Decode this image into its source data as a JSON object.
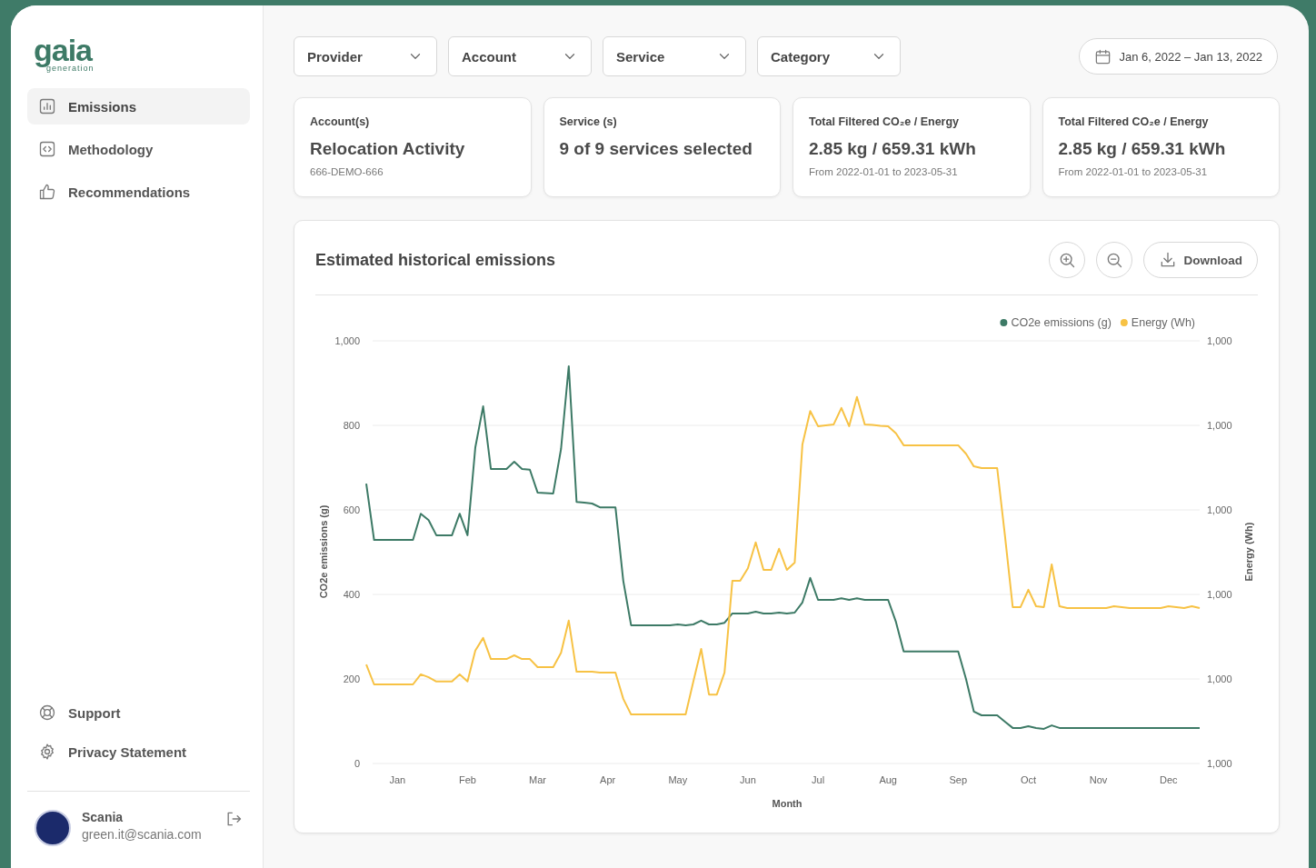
{
  "sidebar": {
    "logo": {
      "wordmark": "gaia",
      "tagline": "generation"
    },
    "nav": [
      {
        "label": "Emissions",
        "selected": true
      },
      {
        "label": "Methodology",
        "selected": false
      },
      {
        "label": "Recommendations",
        "selected": false
      }
    ],
    "footer_links": [
      "Support",
      "Privacy Statement"
    ],
    "user": {
      "name": "Scania",
      "email": "green.it@scania.com"
    }
  },
  "filters": [
    "Provider",
    "Account",
    "Service",
    "Category"
  ],
  "date_range": "Jan 6, 2022 – Jan 13, 2022",
  "cards": [
    {
      "title": "Account(s)",
      "value": "Relocation Activity",
      "detail": "666-DEMO-666"
    },
    {
      "title": "Service (s)",
      "value": "9 of 9 services selected"
    },
    {
      "title": "Total Filtered CO₂e / Energy",
      "value": "2.85 kg / 659.31 kWh",
      "detail": "From 2022-01-01 to 2023-05-31"
    },
    {
      "title": "Total Filtered CO₂e / Energy",
      "value": "2.85 kg / 659.31 kWh",
      "detail": "From 2022-01-01 to 2023-05-31"
    }
  ],
  "chart_panel": {
    "title": "Estimated historical emissions",
    "actions": [
      {
        "kind": "zoom_in"
      },
      {
        "kind": "zoom_out"
      },
      {
        "kind": "download",
        "label": "Download"
      }
    ],
    "chart_data": {
      "type": "line",
      "grid": true,
      "legend": "top-right",
      "xlabel": "Month",
      "ylabel": "CO2e emissions (g)",
      "y2label": "Energy (Wh)",
      "categories": [
        null,
        null,
        null,
        null,
        "Jan",
        null,
        null,
        null,
        null,
        null,
        null,
        null,
        null,
        "Feb",
        null,
        null,
        null,
        null,
        null,
        null,
        null,
        null,
        "Mar",
        null,
        null,
        null,
        null,
        null,
        null,
        null,
        null,
        "Apr",
        null,
        null,
        null,
        null,
        null,
        null,
        null,
        null,
        "May",
        null,
        null,
        null,
        null,
        null,
        null,
        null,
        null,
        "Jun",
        null,
        null,
        null,
        null,
        null,
        null,
        null,
        null,
        "Jul",
        null,
        null,
        null,
        null,
        null,
        null,
        null,
        null,
        "Aug",
        null,
        null,
        null,
        null,
        null,
        null,
        null,
        null,
        "Sep",
        null,
        null,
        null,
        null,
        null,
        null,
        null,
        null,
        "Oct",
        null,
        null,
        null,
        null,
        null,
        null,
        null,
        null,
        "Nov",
        null,
        null,
        null,
        null,
        null,
        null,
        null,
        null,
        "Dec",
        null,
        null,
        null,
        null
      ],
      "series": [
        {
          "name": "CO2e emissions (g)",
          "color": "#3d7a66",
          "values": [
            662,
            529,
            529,
            529,
            529,
            529,
            529,
            591,
            576,
            540,
            540,
            540,
            591,
            540,
            748,
            845,
            697,
            697,
            697,
            714,
            697,
            695,
            641,
            640,
            639,
            744,
            940,
            619,
            617,
            615,
            606,
            606,
            606,
            432,
            327,
            327,
            327,
            327,
            327,
            327,
            329,
            327,
            329,
            338,
            329,
            329,
            333,
            355,
            355,
            355,
            359,
            355,
            355,
            357,
            355,
            357,
            381,
            439,
            387,
            387,
            387,
            391,
            387,
            391,
            387,
            387,
            387,
            387,
            335,
            265,
            265,
            265,
            265,
            265,
            265,
            265,
            265,
            200,
            123,
            114,
            114,
            114,
            99,
            84,
            84,
            88,
            84,
            82,
            90,
            84,
            84,
            84,
            84,
            84,
            84,
            84,
            84,
            84,
            84,
            84,
            84,
            84,
            84,
            84,
            84,
            84,
            84,
            84
          ]
        },
        {
          "name": "Energy (Wh)",
          "color": "#f7c244",
          "values": [
            234,
            187,
            187,
            187,
            187,
            187,
            187,
            211,
            204,
            194,
            194,
            194,
            211,
            194,
            267,
            297,
            247,
            247,
            247,
            256,
            247,
            247,
            228,
            228,
            228,
            262,
            338,
            217,
            217,
            217,
            215,
            215,
            215,
            153,
            116,
            116,
            116,
            116,
            116,
            116,
            116,
            116,
            194,
            271,
            163,
            163,
            215,
            432,
            432,
            462,
            523,
            458,
            458,
            508,
            458,
            475,
            755,
            834,
            798,
            800,
            802,
            841,
            798,
            867,
            802,
            801,
            799,
            798,
            781,
            753,
            753,
            753,
            753,
            753,
            753,
            753,
            753,
            733,
            703,
            699,
            699,
            699,
            540,
            370,
            370,
            411,
            372,
            370,
            471,
            372,
            368,
            368,
            368,
            368,
            368,
            368,
            372,
            370,
            368,
            368,
            368,
            368,
            368,
            372,
            370,
            368,
            372,
            368
          ]
        }
      ],
      "ylim": [
        0,
        1000
      ],
      "yticks": [
        0,
        200,
        400,
        600,
        800,
        {
          "value": 1000,
          "label": "1,000"
        }
      ],
      "y2ticks": [
        "1,000",
        "1,000",
        "1,000",
        "1,000",
        "1,000",
        "1,000"
      ]
    }
  }
}
